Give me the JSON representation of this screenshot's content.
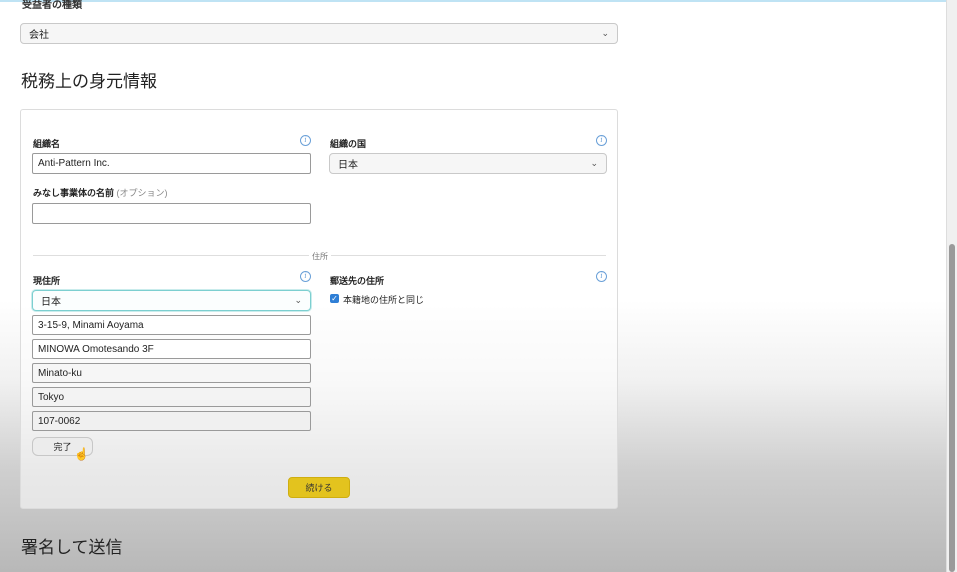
{
  "beneficiary_type": {
    "label": "受益者の種類",
    "value": "会社"
  },
  "tax_identity": {
    "title": "税務上の身元情報",
    "org_name_label": "組織名",
    "org_name_value": "Anti-Pattern Inc.",
    "org_country_label": "組織の国",
    "org_country_value": "日本",
    "dba_label": "みなし事業体の名前",
    "dba_optional": "(オプション)",
    "dba_value": "",
    "address_divider": "住所",
    "current_address_label": "現住所",
    "current_country_value": "日本",
    "address_lines": [
      "3-15-9, Minami Aoyama",
      "MINOWA Omotesando 3F",
      "Minato-ku",
      "Tokyo",
      "107-0062"
    ],
    "mailing_address_label": "郵送先の住所",
    "same_as_registered": "本籍地の住所と同じ",
    "done_button": "完了",
    "continue_button": "続ける"
  },
  "sign_section": {
    "title": "署名して送信"
  },
  "icons": {
    "info": "i",
    "chevron": "⌄",
    "check": "✓",
    "hand_cursor": "☝"
  },
  "colors": {
    "accent_button": "#e3c31e",
    "checkbox": "#2f7fd6",
    "info_icon": "#6aa0d8"
  }
}
